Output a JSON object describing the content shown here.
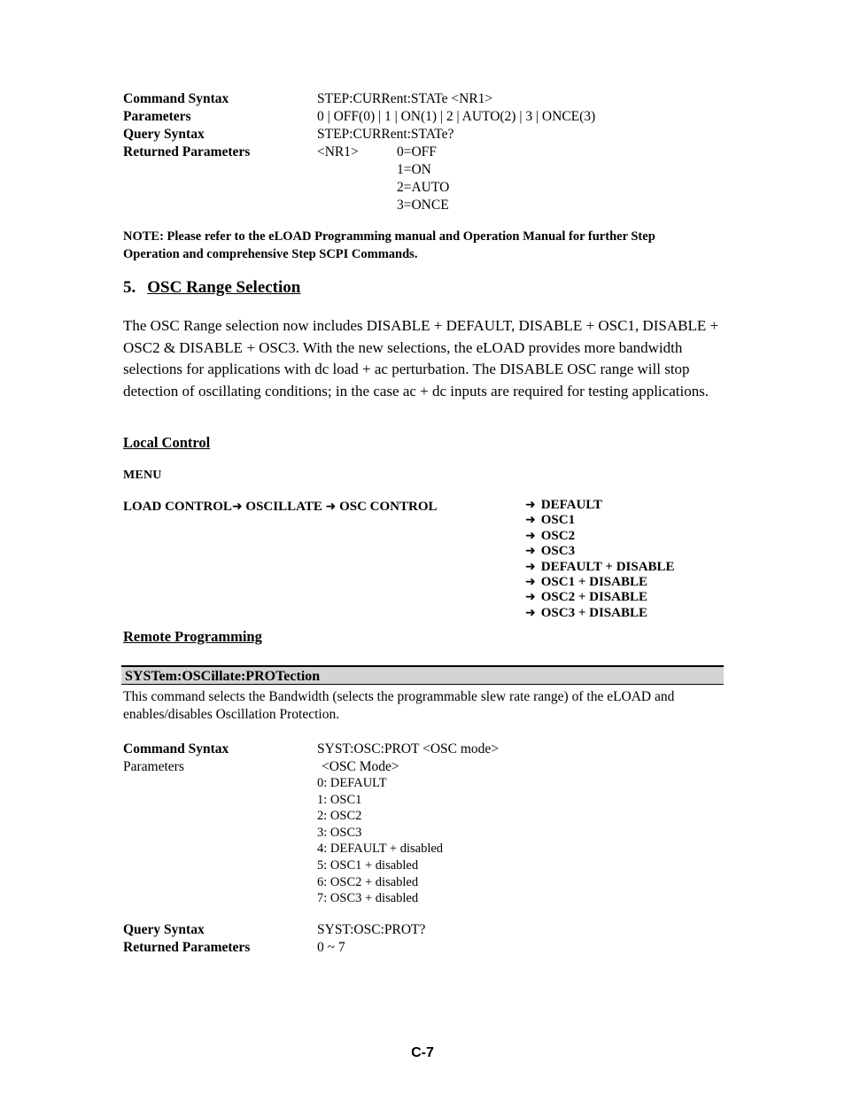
{
  "document": {
    "footer_page_label": "C-7"
  },
  "step_current_state_block": {
    "rows": [
      {
        "label": "Command Syntax",
        "bold": true,
        "value": "STEP:CURRent:STATe <NR1>"
      },
      {
        "label": "Parameters",
        "bold": true,
        "value": "0 | OFF(0) | 1 | ON(1) | 2 | AUTO(2) | 3 | ONCE(3)"
      },
      {
        "label": "Query Syntax",
        "bold": true,
        "value": "STEP:CURRent:STATe?"
      },
      {
        "label": "Returned Parameters",
        "bold": true,
        "value": "<NR1>"
      }
    ],
    "returned_enum": [
      "0=OFF",
      "1=ON",
      "2=AUTO",
      "3=ONCE"
    ]
  },
  "note": {
    "text": "NOTE:  Please refer to the eLOAD Programming manual and Operation Manual for further Step Operation and comprehensive Step SCPI Commands."
  },
  "section": {
    "number": "5.",
    "title": "OSC Range Selection",
    "paragraph": "The OSC Range selection now includes DISABLE + DEFAULT, DISABLE + OSC1, DISABLE + OSC2 & DISABLE + OSC3.  With the new selections, the eLOAD provides more bandwidth selections for applications with dc load + ac perturbation.  The DISABLE OSC range will stop detection of oscillating conditions; in the case ac + dc inputs are required for testing applications."
  },
  "local_control": {
    "heading": "Local Control",
    "menu_label": "MENU",
    "path": {
      "item1": "LOAD CONTROL",
      "arrow": "➜",
      "item2": "OSCILLATE",
      "item3": "OSC CONTROL"
    },
    "options": [
      "DEFAULT",
      "OSC1",
      "OSC2",
      "OSC3",
      "DEFAULT + DISABLE",
      "OSC1 + DISABLE",
      "OSC2 + DISABLE",
      "OSC3 + DISABLE"
    ],
    "option_arrow": "➜"
  },
  "remote_programming": {
    "heading": "Remote Programming",
    "command_title": "SYSTem:OSCillate:PROTection",
    "description": "This command selects the Bandwidth (selects the programmable slew rate range) of the eLOAD and enables/disables Oscillation Protection.",
    "rows": [
      {
        "label": "Command Syntax",
        "bold": true,
        "value": "SYST:OSC:PROT <OSC mode>"
      },
      {
        "label": "Parameters",
        "bold": false,
        "value": "<OSC Mode>"
      }
    ],
    "parameter_values": [
      "0: DEFAULT",
      "1: OSC1",
      "2: OSC2",
      "3: OSC3",
      "4: DEFAULT + disabled",
      "5: OSC1 + disabled",
      "6: OSC2 + disabled",
      "7: OSC3 + disabled"
    ],
    "tail_rows": [
      {
        "label": "Query Syntax",
        "bold": true,
        "value": "SYST:OSC:PROT?"
      },
      {
        "label": "Returned Parameters",
        "bold": true,
        "value": "0 ~ 7"
      }
    ]
  },
  "colors": {
    "command_bar_background": "#d4d4d4",
    "text": "#000000",
    "page_background": "#ffffff"
  }
}
